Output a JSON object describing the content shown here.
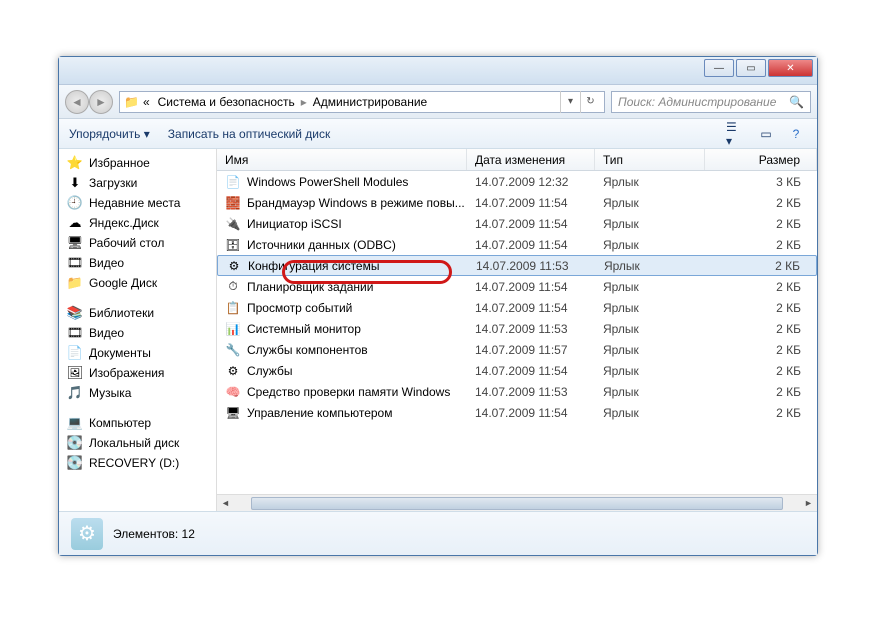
{
  "breadcrumb": {
    "prefix": "«",
    "parent": "Система и безопасность",
    "current": "Администрирование"
  },
  "search": {
    "placeholder": "Поиск: Администрирование"
  },
  "toolbar": {
    "organize": "Упорядочить ▾",
    "burn": "Записать на оптический диск"
  },
  "columns": {
    "name": "Имя",
    "date": "Дата изменения",
    "type": "Тип",
    "size": "Размер"
  },
  "sidebar": {
    "favorites": {
      "label": "Избранное",
      "items": [
        {
          "icon": "⬇",
          "label": "Загрузки"
        },
        {
          "icon": "🕘",
          "label": "Недавние места"
        },
        {
          "icon": "☁",
          "label": "Яндекс.Диск"
        },
        {
          "icon": "🖥",
          "label": "Рабочий стол"
        },
        {
          "icon": "🎞",
          "label": "Видео"
        },
        {
          "icon": "📁",
          "label": "Google Диск"
        }
      ]
    },
    "libraries": {
      "label": "Библиотеки",
      "items": [
        {
          "icon": "🎞",
          "label": "Видео"
        },
        {
          "icon": "📄",
          "label": "Документы"
        },
        {
          "icon": "🖼",
          "label": "Изображения"
        },
        {
          "icon": "🎵",
          "label": "Музыка"
        }
      ]
    },
    "computer": {
      "label": "Компьютер",
      "items": [
        {
          "icon": "💽",
          "label": "Локальный диск"
        },
        {
          "icon": "💽",
          "label": "RECOVERY (D:)"
        }
      ]
    }
  },
  "files": [
    {
      "icon": "📄",
      "name": "Windows PowerShell Modules",
      "date": "14.07.2009 12:32",
      "type": "Ярлык",
      "size": "3 КБ"
    },
    {
      "icon": "🧱",
      "name": "Брандмауэр Windows в режиме повы...",
      "date": "14.07.2009 11:54",
      "type": "Ярлык",
      "size": "2 КБ"
    },
    {
      "icon": "🔌",
      "name": "Инициатор iSCSI",
      "date": "14.07.2009 11:54",
      "type": "Ярлык",
      "size": "2 КБ"
    },
    {
      "icon": "🗄",
      "name": "Источники данных (ODBC)",
      "date": "14.07.2009 11:54",
      "type": "Ярлык",
      "size": "2 КБ"
    },
    {
      "icon": "⚙",
      "name": "Конфигурация системы",
      "date": "14.07.2009 11:53",
      "type": "Ярлык",
      "size": "2 КБ",
      "selected": true
    },
    {
      "icon": "⏱",
      "name": "Планировщик заданий",
      "date": "14.07.2009 11:54",
      "type": "Ярлык",
      "size": "2 КБ"
    },
    {
      "icon": "📋",
      "name": "Просмотр событий",
      "date": "14.07.2009 11:54",
      "type": "Ярлык",
      "size": "2 КБ"
    },
    {
      "icon": "📊",
      "name": "Системный монитор",
      "date": "14.07.2009 11:53",
      "type": "Ярлык",
      "size": "2 КБ"
    },
    {
      "icon": "🔧",
      "name": "Службы компонентов",
      "date": "14.07.2009 11:57",
      "type": "Ярлык",
      "size": "2 КБ"
    },
    {
      "icon": "⚙",
      "name": "Службы",
      "date": "14.07.2009 11:54",
      "type": "Ярлык",
      "size": "2 КБ"
    },
    {
      "icon": "🧠",
      "name": "Средство проверки памяти Windows",
      "date": "14.07.2009 11:53",
      "type": "Ярлык",
      "size": "2 КБ"
    },
    {
      "icon": "🖥",
      "name": "Управление компьютером",
      "date": "14.07.2009 11:54",
      "type": "Ярлык",
      "size": "2 КБ"
    }
  ],
  "status": {
    "text": "Элементов: 12"
  }
}
